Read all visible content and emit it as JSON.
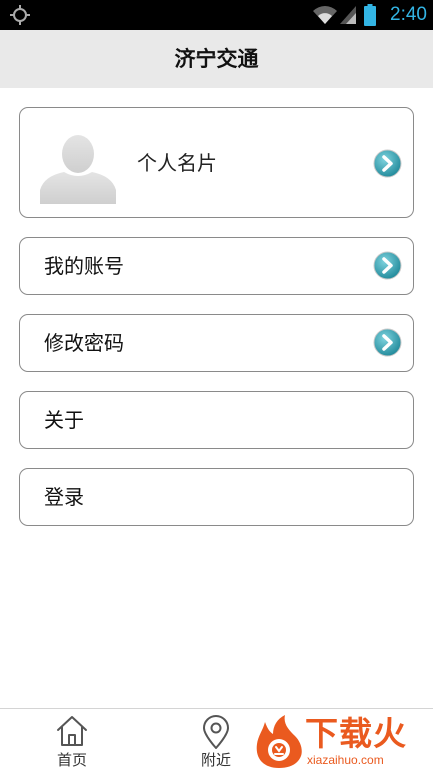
{
  "status_bar": {
    "time": "2:40",
    "icons": [
      "location-icon",
      "wifi-icon",
      "signal-icon",
      "battery-icon"
    ],
    "time_color": "#33b5e5"
  },
  "header": {
    "title": "济宁交通"
  },
  "profile": {
    "label": "个人名片",
    "avatar_icon": "default-avatar-icon"
  },
  "menu": {
    "items": [
      {
        "label": "我的账号",
        "has_arrow": true
      },
      {
        "label": "修改密码",
        "has_arrow": true
      },
      {
        "label": "关于",
        "has_arrow": false
      },
      {
        "label": "登录",
        "has_arrow": false
      }
    ]
  },
  "bottom_nav": {
    "items": [
      {
        "label": "首页",
        "icon": "home-icon"
      },
      {
        "label": "附近",
        "icon": "map-pin-icon"
      }
    ]
  },
  "watermark": {
    "main_text": "下载火",
    "site": "xiazaihuo.com",
    "color": "#ea5a1f"
  },
  "colors": {
    "arrow_teal": "#2a9eb0",
    "header_bg": "#e9e9e9"
  }
}
